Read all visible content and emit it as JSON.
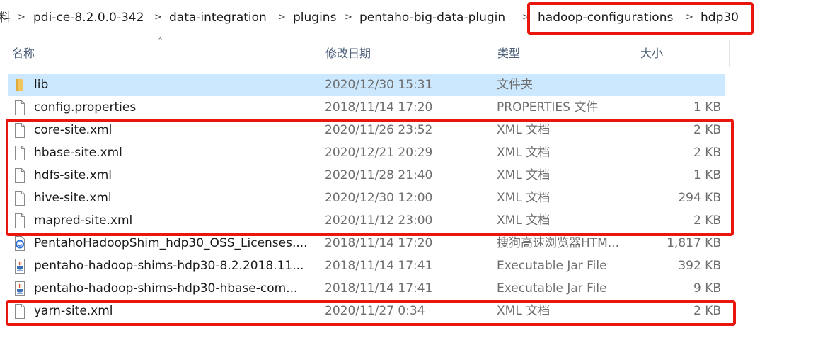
{
  "breadcrumb": {
    "items": [
      "料",
      "pdi-ce-8.2.0.0-342",
      "data-integration",
      "plugins",
      "pentaho-big-data-plugin",
      "hadoop-configurations",
      "hdp30"
    ],
    "separator": ">"
  },
  "columns": {
    "name": "名称",
    "date": "修改日期",
    "type": "类型",
    "size": "大小"
  },
  "files": [
    {
      "name": "lib",
      "date": "2020/12/30 15:31",
      "type": "文件夹",
      "size": "",
      "icon": "folder-icon",
      "selected": true
    },
    {
      "name": "config.properties",
      "date": "2018/11/14 17:20",
      "type": "PROPERTIES 文件",
      "size": "1 KB",
      "icon": "file-icon"
    },
    {
      "name": "core-site.xml",
      "date": "2020/11/26 23:52",
      "type": "XML 文档",
      "size": "2 KB",
      "icon": "file-icon"
    },
    {
      "name": "hbase-site.xml",
      "date": "2020/12/21 20:29",
      "type": "XML 文档",
      "size": "2 KB",
      "icon": "file-icon"
    },
    {
      "name": "hdfs-site.xml",
      "date": "2020/11/28 21:40",
      "type": "XML 文档",
      "size": "1 KB",
      "icon": "file-icon"
    },
    {
      "name": "hive-site.xml",
      "date": "2020/12/30 12:00",
      "type": "XML 文档",
      "size": "294 KB",
      "icon": "file-icon"
    },
    {
      "name": "mapred-site.xml",
      "date": "2020/11/12 23:00",
      "type": "XML 文档",
      "size": "2 KB",
      "icon": "file-icon"
    },
    {
      "name": "PentahoHadoopShim_hdp30_OSS_Licenses....",
      "date": "2018/11/14 17:20",
      "type": "搜狗高速浏览器HTM...",
      "size": "1,817 KB",
      "icon": "browser-html-icon"
    },
    {
      "name": "pentaho-hadoop-shims-hdp30-8.2.2018.11...",
      "date": "2018/11/14 17:41",
      "type": "Executable Jar File",
      "size": "392 KB",
      "icon": "java-jar-icon"
    },
    {
      "name": "pentaho-hadoop-shims-hdp30-hbase-com...",
      "date": "2018/11/14 17:41",
      "type": "Executable Jar File",
      "size": "9 KB",
      "icon": "java-jar-icon"
    },
    {
      "name": "yarn-site.xml",
      "date": "2020/11/27 0:34",
      "type": "XML 文档",
      "size": "2 KB",
      "icon": "file-icon"
    }
  ],
  "colors": {
    "highlight": "#e8160c",
    "selected_row": "#cce8ff",
    "folder": "#f2c55c"
  }
}
